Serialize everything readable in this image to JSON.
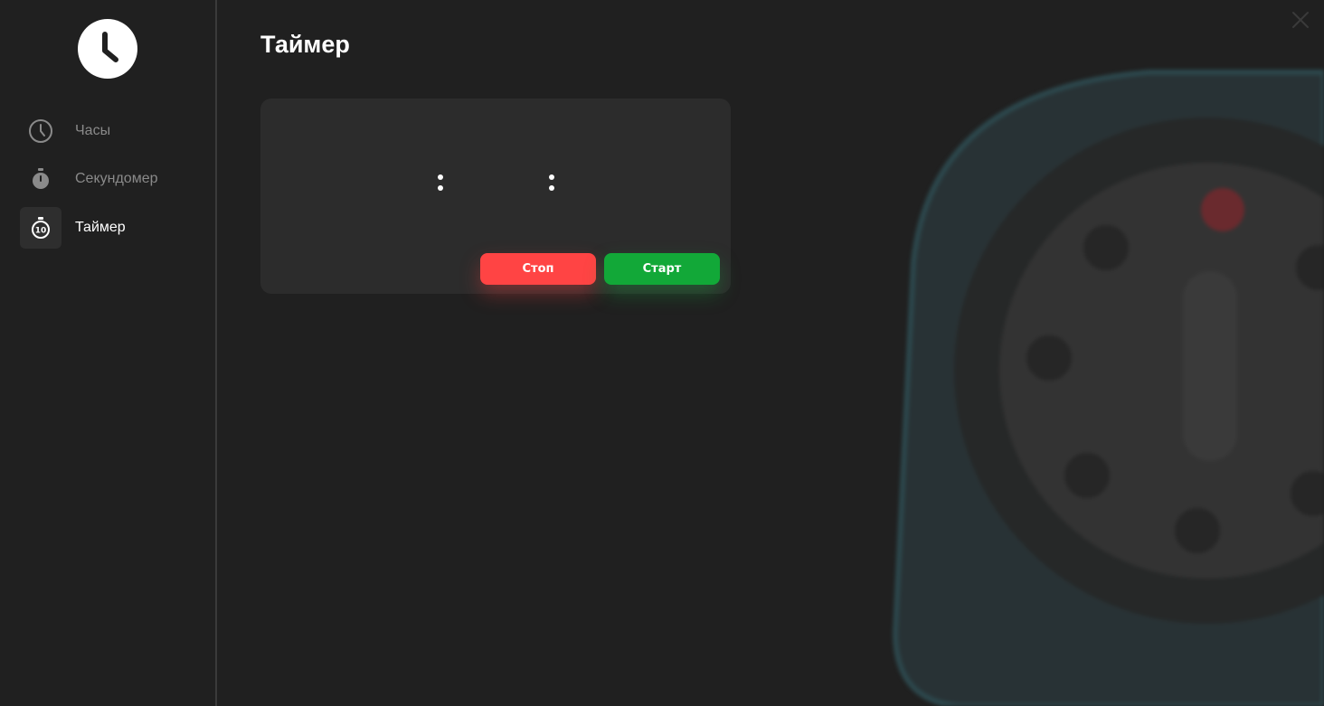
{
  "app": {
    "title": "Таймер"
  },
  "sidebar": {
    "logo_icon": "clock-logo-icon",
    "items": [
      {
        "label": "Часы",
        "icon": "clock-icon",
        "active": false
      },
      {
        "label": "Секундомер",
        "icon": "stopwatch-icon",
        "active": false
      },
      {
        "label": "Таймер",
        "icon": "timer-icon",
        "active": true
      }
    ]
  },
  "timer": {
    "hours": {
      "value": "",
      "placeholder": ""
    },
    "minutes": {
      "value": "",
      "placeholder": ""
    },
    "seconds": {
      "value": "",
      "placeholder": ""
    },
    "stop_label": "Стоп",
    "start_label": "Старт"
  },
  "window": {
    "close_icon": "close-icon"
  },
  "colors": {
    "background": "#202020",
    "card": "#2c2c2c",
    "stop": "#ff4444",
    "start": "#12a838",
    "active_nav": "#2e2e2e",
    "muted_text": "#8a8a8a"
  }
}
